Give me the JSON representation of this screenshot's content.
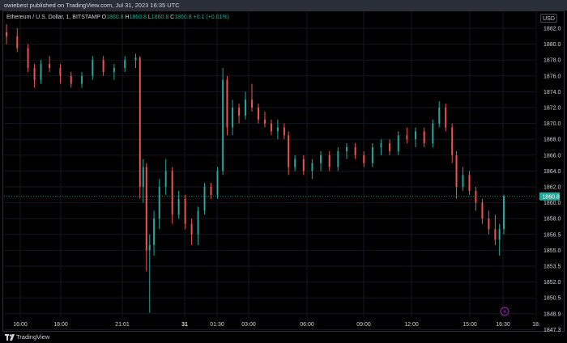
{
  "header": {
    "published_text": "owiebest published on TradingView.com, Jul 31, 2023 16:35 UTC"
  },
  "legend": {
    "symbol": "Ethereum / U.S. Dollar, 1, BITSTAMP",
    "o_label": "O",
    "o_value": "1860.8",
    "h_label": "H",
    "h_value": "1860.8",
    "l_label": "L",
    "l_value": "1860.8",
    "c_label": "C",
    "c_value": "1860.8",
    "change": "+0.1 (+0.01%)"
  },
  "currency_button": "USD",
  "footer": {
    "brand": "TradingView"
  },
  "colors": {
    "up": "#26a69a",
    "down": "#ef5350",
    "price_line": "#26a69a",
    "grid": "#131722",
    "axis_text": "#d1d4dc"
  },
  "chart_data": {
    "type": "candlestick",
    "price_label": "1860.8",
    "last_price": 1860.8,
    "y_ticks": [
      1882.0,
      1880.0,
      1878.0,
      1876.0,
      1874.0,
      1872.0,
      1870.0,
      1868.0,
      1866.0,
      1864.0,
      1862.0,
      1860.0,
      1858.0,
      1856.5,
      1855.0,
      1853.5,
      1852.0,
      1850.5,
      1848.9,
      1847.3
    ],
    "x_ticks": [
      "16:00",
      "18:00",
      "21:01",
      "31",
      "01:30",
      "03:00",
      "06:00",
      "09:00",
      "12:00",
      "15:00",
      "16:30",
      "18:"
    ],
    "events_icon": "lightning-icon",
    "candles": [
      {
        "t": 0.0,
        "o": 1881.5,
        "h": 1882.5,
        "l": 1880.0,
        "c": 1881.0
      },
      {
        "t": 0.5,
        "o": 1881.0,
        "h": 1882.0,
        "l": 1879.0,
        "c": 1879.5
      },
      {
        "t": 1.0,
        "o": 1879.5,
        "h": 1880.0,
        "l": 1876.5,
        "c": 1877.0
      },
      {
        "t": 1.3,
        "o": 1877.0,
        "h": 1877.5,
        "l": 1874.5,
        "c": 1875.5
      },
      {
        "t": 1.6,
        "o": 1875.5,
        "h": 1878.0,
        "l": 1875.0,
        "c": 1877.5
      },
      {
        "t": 2.0,
        "o": 1877.5,
        "h": 1878.5,
        "l": 1876.5,
        "c": 1877.0
      },
      {
        "t": 2.5,
        "o": 1877.0,
        "h": 1877.5,
        "l": 1875.0,
        "c": 1876.0
      },
      {
        "t": 3.0,
        "o": 1876.0,
        "h": 1876.5,
        "l": 1874.5,
        "c": 1875.0
      },
      {
        "t": 3.5,
        "o": 1875.0,
        "h": 1876.5,
        "l": 1874.5,
        "c": 1876.0
      },
      {
        "t": 4.0,
        "o": 1876.0,
        "h": 1878.5,
        "l": 1875.5,
        "c": 1878.0
      },
      {
        "t": 4.5,
        "o": 1878.0,
        "h": 1878.5,
        "l": 1876.0,
        "c": 1876.5
      },
      {
        "t": 5.0,
        "o": 1876.5,
        "h": 1877.5,
        "l": 1875.5,
        "c": 1877.0
      },
      {
        "t": 5.5,
        "o": 1877.0,
        "h": 1878.5,
        "l": 1876.5,
        "c": 1878.0
      },
      {
        "t": 6.0,
        "o": 1878.0,
        "h": 1878.8,
        "l": 1877.0,
        "c": 1878.3
      },
      {
        "t": 6.2,
        "o": 1878.3,
        "h": 1878.5,
        "l": 1860.5,
        "c": 1862.0
      },
      {
        "t": 6.35,
        "o": 1862.0,
        "h": 1865.5,
        "l": 1860.0,
        "c": 1864.5
      },
      {
        "t": 6.5,
        "o": 1864.5,
        "h": 1865.0,
        "l": 1853.0,
        "c": 1855.0
      },
      {
        "t": 6.65,
        "o": 1855.0,
        "h": 1856.5,
        "l": 1849.0,
        "c": 1855.5
      },
      {
        "t": 6.85,
        "o": 1855.5,
        "h": 1859.0,
        "l": 1854.5,
        "c": 1858.0
      },
      {
        "t": 7.1,
        "o": 1858.0,
        "h": 1863.0,
        "l": 1857.0,
        "c": 1862.0
      },
      {
        "t": 7.4,
        "o": 1862.0,
        "h": 1865.5,
        "l": 1861.0,
        "c": 1864.0
      },
      {
        "t": 7.7,
        "o": 1864.0,
        "h": 1864.5,
        "l": 1857.5,
        "c": 1858.5
      },
      {
        "t": 8.0,
        "o": 1858.5,
        "h": 1861.5,
        "l": 1858.0,
        "c": 1860.5
      },
      {
        "t": 8.3,
        "o": 1860.5,
        "h": 1861.0,
        "l": 1857.0,
        "c": 1857.5
      },
      {
        "t": 8.6,
        "o": 1857.5,
        "h": 1858.0,
        "l": 1855.5,
        "c": 1856.5
      },
      {
        "t": 8.9,
        "o": 1856.5,
        "h": 1859.5,
        "l": 1855.5,
        "c": 1859.0
      },
      {
        "t": 9.2,
        "o": 1859.0,
        "h": 1862.5,
        "l": 1858.5,
        "c": 1862.0
      },
      {
        "t": 9.5,
        "o": 1862.0,
        "h": 1862.5,
        "l": 1860.5,
        "c": 1861.0
      },
      {
        "t": 9.8,
        "o": 1861.0,
        "h": 1864.5,
        "l": 1860.5,
        "c": 1864.0
      },
      {
        "t": 10.05,
        "o": 1864.0,
        "h": 1877.0,
        "l": 1863.5,
        "c": 1875.5
      },
      {
        "t": 10.25,
        "o": 1875.5,
        "h": 1876.0,
        "l": 1868.5,
        "c": 1869.5
      },
      {
        "t": 10.5,
        "o": 1869.5,
        "h": 1873.0,
        "l": 1868.5,
        "c": 1872.0
      },
      {
        "t": 10.8,
        "o": 1872.0,
        "h": 1872.5,
        "l": 1870.0,
        "c": 1871.0
      },
      {
        "t": 11.1,
        "o": 1871.0,
        "h": 1874.0,
        "l": 1870.5,
        "c": 1873.0
      },
      {
        "t": 11.4,
        "o": 1873.0,
        "h": 1875.0,
        "l": 1871.5,
        "c": 1872.0
      },
      {
        "t": 11.7,
        "o": 1872.0,
        "h": 1872.5,
        "l": 1870.0,
        "c": 1870.5
      },
      {
        "t": 12.0,
        "o": 1870.5,
        "h": 1871.5,
        "l": 1869.5,
        "c": 1870.0
      },
      {
        "t": 12.3,
        "o": 1870.0,
        "h": 1870.5,
        "l": 1868.5,
        "c": 1869.0
      },
      {
        "t": 12.6,
        "o": 1869.0,
        "h": 1870.5,
        "l": 1868.0,
        "c": 1869.5
      },
      {
        "t": 12.9,
        "o": 1869.5,
        "h": 1870.0,
        "l": 1868.0,
        "c": 1868.5
      },
      {
        "t": 13.1,
        "o": 1868.5,
        "h": 1869.0,
        "l": 1863.5,
        "c": 1864.5
      },
      {
        "t": 13.4,
        "o": 1864.5,
        "h": 1866.0,
        "l": 1864.0,
        "c": 1865.5
      },
      {
        "t": 13.8,
        "o": 1865.5,
        "h": 1866.0,
        "l": 1863.5,
        "c": 1864.0
      },
      {
        "t": 14.2,
        "o": 1864.0,
        "h": 1865.5,
        "l": 1863.0,
        "c": 1865.0
      },
      {
        "t": 14.6,
        "o": 1865.0,
        "h": 1866.5,
        "l": 1864.0,
        "c": 1866.0
      },
      {
        "t": 15.0,
        "o": 1866.0,
        "h": 1866.5,
        "l": 1864.0,
        "c": 1864.5
      },
      {
        "t": 15.4,
        "o": 1864.5,
        "h": 1867.0,
        "l": 1864.0,
        "c": 1866.5
      },
      {
        "t": 15.8,
        "o": 1866.5,
        "h": 1867.5,
        "l": 1865.5,
        "c": 1867.0
      },
      {
        "t": 16.2,
        "o": 1867.0,
        "h": 1867.5,
        "l": 1865.5,
        "c": 1866.0
      },
      {
        "t": 16.6,
        "o": 1866.0,
        "h": 1866.5,
        "l": 1864.5,
        "c": 1865.0
      },
      {
        "t": 17.0,
        "o": 1865.0,
        "h": 1867.5,
        "l": 1864.5,
        "c": 1867.0
      },
      {
        "t": 17.4,
        "o": 1867.0,
        "h": 1868.0,
        "l": 1866.0,
        "c": 1867.5
      },
      {
        "t": 17.8,
        "o": 1867.5,
        "h": 1868.0,
        "l": 1866.0,
        "c": 1866.5
      },
      {
        "t": 18.2,
        "o": 1866.5,
        "h": 1869.0,
        "l": 1866.0,
        "c": 1868.5
      },
      {
        "t": 18.6,
        "o": 1868.5,
        "h": 1869.5,
        "l": 1867.5,
        "c": 1868.0
      },
      {
        "t": 19.0,
        "o": 1868.0,
        "h": 1869.5,
        "l": 1867.0,
        "c": 1869.0
      },
      {
        "t": 19.4,
        "o": 1869.0,
        "h": 1869.5,
        "l": 1867.0,
        "c": 1867.5
      },
      {
        "t": 19.8,
        "o": 1867.5,
        "h": 1870.5,
        "l": 1867.0,
        "c": 1870.0
      },
      {
        "t": 20.1,
        "o": 1870.0,
        "h": 1872.8,
        "l": 1869.5,
        "c": 1872.0
      },
      {
        "t": 20.4,
        "o": 1872.0,
        "h": 1872.5,
        "l": 1869.0,
        "c": 1869.5
      },
      {
        "t": 20.7,
        "o": 1869.5,
        "h": 1870.0,
        "l": 1865.0,
        "c": 1866.0
      },
      {
        "t": 20.9,
        "o": 1866.0,
        "h": 1866.5,
        "l": 1860.5,
        "c": 1862.0
      },
      {
        "t": 21.2,
        "o": 1862.0,
        "h": 1864.5,
        "l": 1861.5,
        "c": 1863.5
      },
      {
        "t": 21.5,
        "o": 1863.5,
        "h": 1864.0,
        "l": 1861.0,
        "c": 1861.5
      },
      {
        "t": 21.8,
        "o": 1861.5,
        "h": 1862.0,
        "l": 1859.0,
        "c": 1860.0
      },
      {
        "t": 22.1,
        "o": 1860.0,
        "h": 1860.5,
        "l": 1857.5,
        "c": 1858.0
      },
      {
        "t": 22.4,
        "o": 1858.0,
        "h": 1859.0,
        "l": 1856.5,
        "c": 1857.0
      },
      {
        "t": 22.7,
        "o": 1857.0,
        "h": 1858.5,
        "l": 1855.5,
        "c": 1856.0
      },
      {
        "t": 22.9,
        "o": 1856.0,
        "h": 1857.5,
        "l": 1854.5,
        "c": 1857.0
      },
      {
        "t": 23.1,
        "o": 1857.0,
        "h": 1861.0,
        "l": 1856.5,
        "c": 1860.8
      }
    ]
  }
}
